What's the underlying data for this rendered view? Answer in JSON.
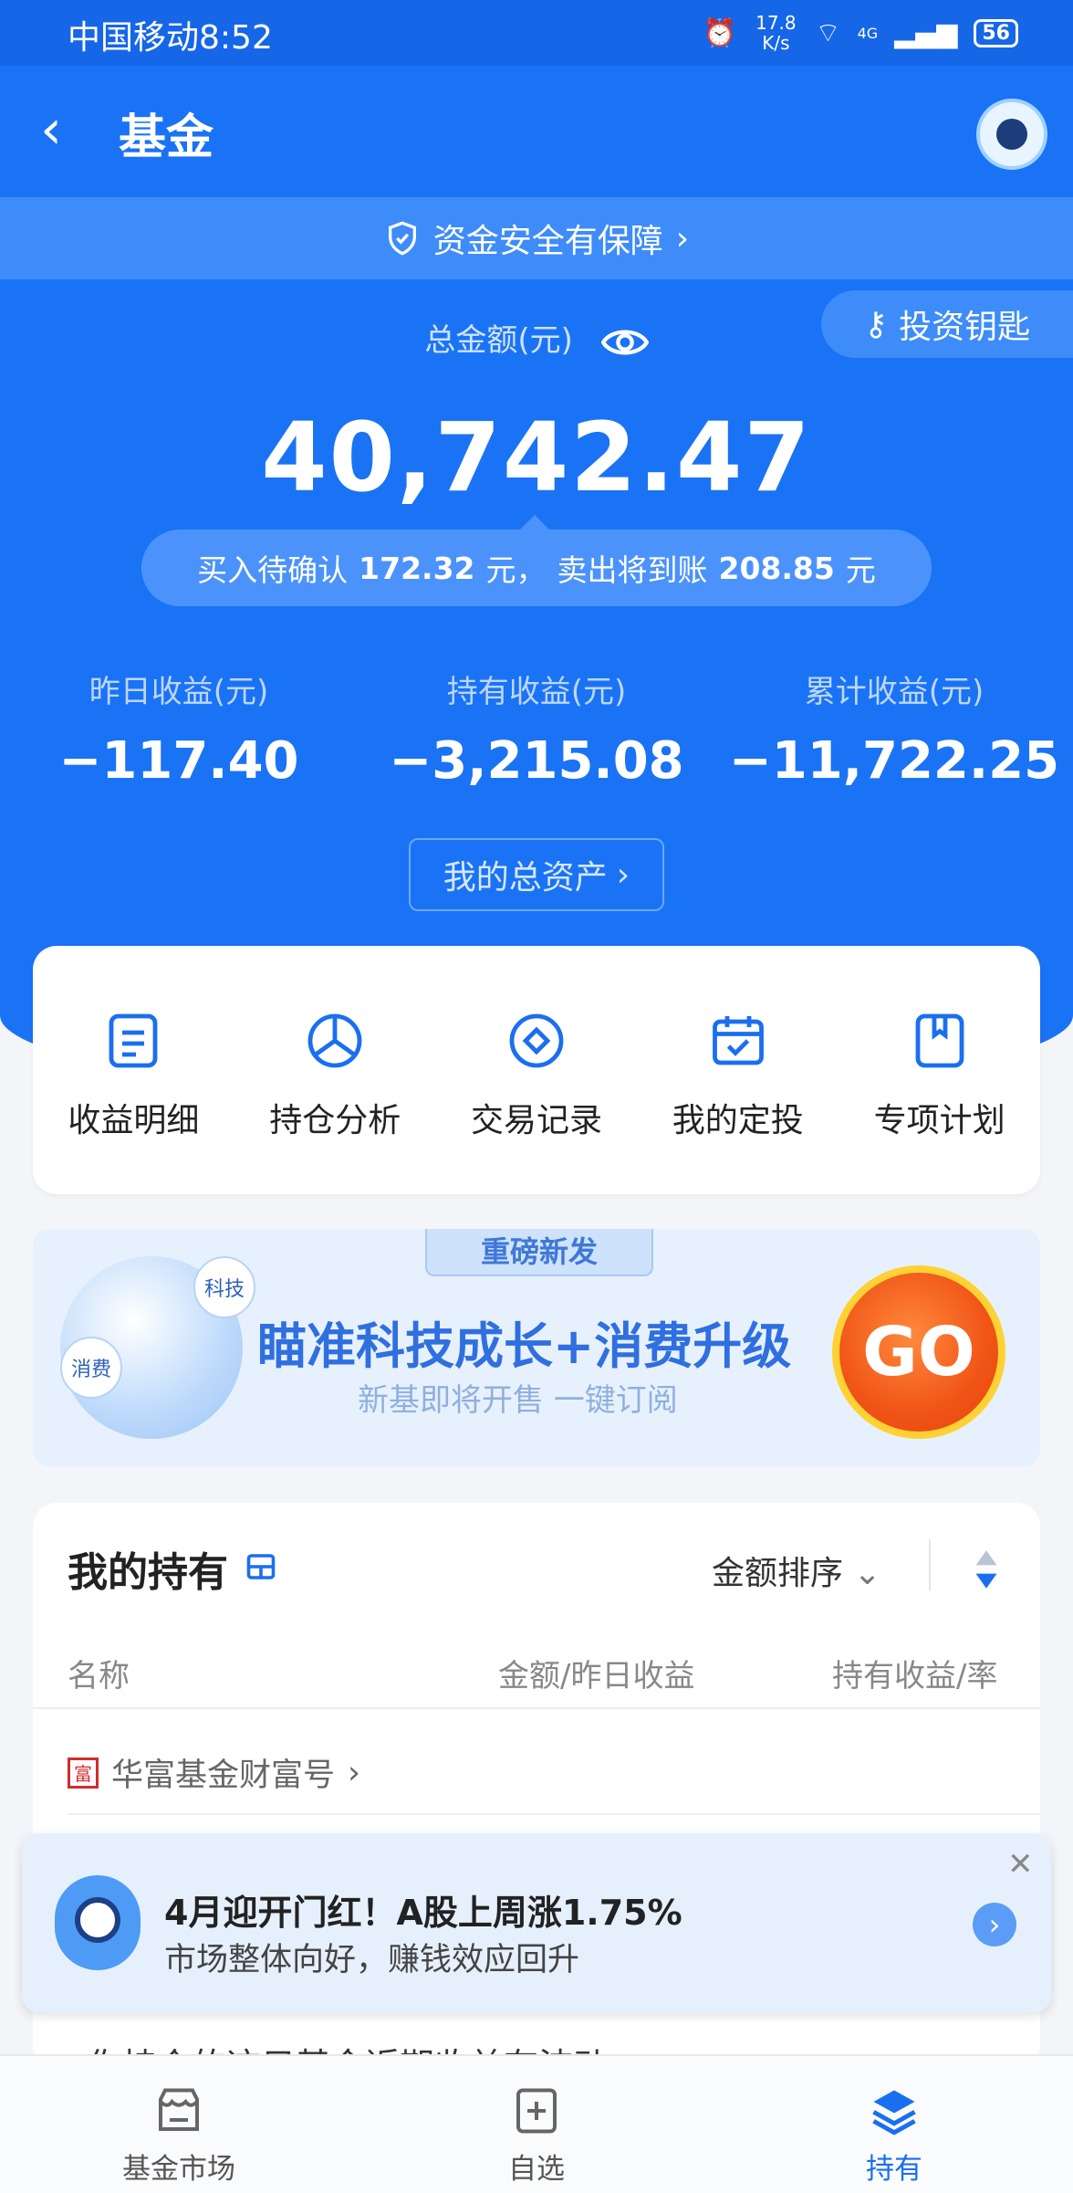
{
  "status_bar": {
    "carrier_time": "中国移动8:52",
    "net_speed": "17.8 K/s",
    "network": "4G",
    "battery": "56"
  },
  "nav": {
    "title": "基金"
  },
  "secure_banner": {
    "label": "资金安全有保障"
  },
  "key_button": {
    "label": "投资钥匙"
  },
  "total": {
    "label": "总金额(元)",
    "value": "40,742.47"
  },
  "pending": {
    "buy_label": "买入待确认",
    "buy_value": "172.32",
    "buy_unit": "元，",
    "sell_label": "卖出将到账",
    "sell_value": "208.85",
    "sell_unit": "元"
  },
  "stats": [
    {
      "label": "昨日收益(元)",
      "value": "−117.40"
    },
    {
      "label": "持有收益(元)",
      "value": "−3,215.08"
    },
    {
      "label": "累计收益(元)",
      "value": "−11,722.25"
    }
  ],
  "assets_button": {
    "label": "我的总资产"
  },
  "menu": [
    {
      "label": "收益明细",
      "icon": "document-icon"
    },
    {
      "label": "持仓分析",
      "icon": "pie-chart-icon"
    },
    {
      "label": "交易记录",
      "icon": "diamond-icon"
    },
    {
      "label": "我的定投",
      "icon": "calendar-check-icon"
    },
    {
      "label": "专项计划",
      "icon": "bookmark-icon"
    }
  ],
  "banner": {
    "tag": "重磅新发",
    "bubble1": "科技",
    "bubble2": "消费",
    "title": "瞄准科技成长+消费升级",
    "subtitle": "新基即将开售 一键订阅",
    "go": "GO"
  },
  "holdings": {
    "title": "我的持有",
    "sort": "金额排序",
    "columns": [
      "名称",
      "金额/昨日收益",
      "持有收益/率"
    ],
    "group": {
      "seal": "富",
      "label": "华富基金财富号"
    },
    "peek_text": "你持仓的这只基金近期收益有波动"
  },
  "toast": {
    "title": "4月迎开门红！A股上周涨1.75%",
    "subtitle": "市场整体向好，赚钱效应回升"
  },
  "tabs": [
    {
      "label": "基金市场",
      "icon": "market-icon"
    },
    {
      "label": "自选",
      "icon": "add-watchlist-icon"
    },
    {
      "label": "持有",
      "icon": "layers-icon"
    }
  ],
  "colors": {
    "primary": "#1a73f5",
    "accent_orange": "#f05417"
  }
}
